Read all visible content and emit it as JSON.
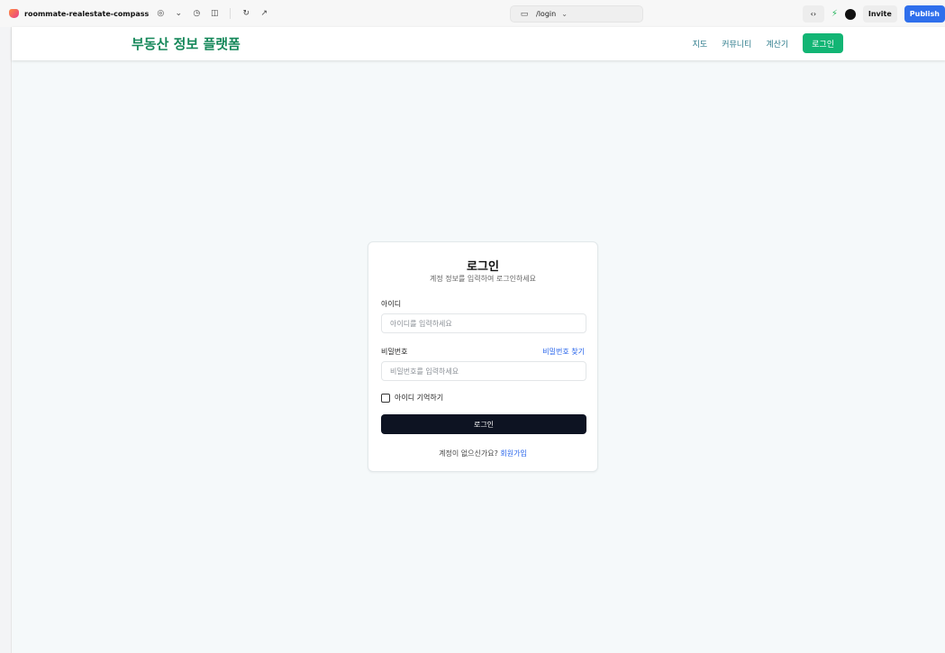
{
  "toolbar": {
    "project_name": "roommate-realestate-compass",
    "url": "/login",
    "invite": "Invite",
    "publish": "Publish",
    "code_icon": "‹›"
  },
  "header": {
    "brand": "부동산 정보 플랫폼",
    "nav": [
      {
        "label": "지도"
      },
      {
        "label": "커뮤니티"
      },
      {
        "label": "계산기"
      }
    ],
    "login": "로그인"
  },
  "card": {
    "title": "로그인",
    "subtitle": "계정 정보를 입력하여 로그인하세요",
    "id_label": "아이디",
    "id_placeholder": "아이디를 입력하세요",
    "id_value": "",
    "pw_label": "비밀번호",
    "pw_placeholder": "비밀번호를 입력하세요",
    "pw_value": "",
    "forgot": "비밀번호 찾기",
    "remember": "아이디 기억하기",
    "submit": "로그인",
    "signup_prompt": "계정이 없으신가요?",
    "signup_link": "회원가입"
  },
  "colors": {
    "brand_green": "#16885a",
    "login_button_green": "#12b574",
    "submit_dark": "#0d1322",
    "link_blue": "#2563eb",
    "publish_blue": "#2f6fec"
  }
}
